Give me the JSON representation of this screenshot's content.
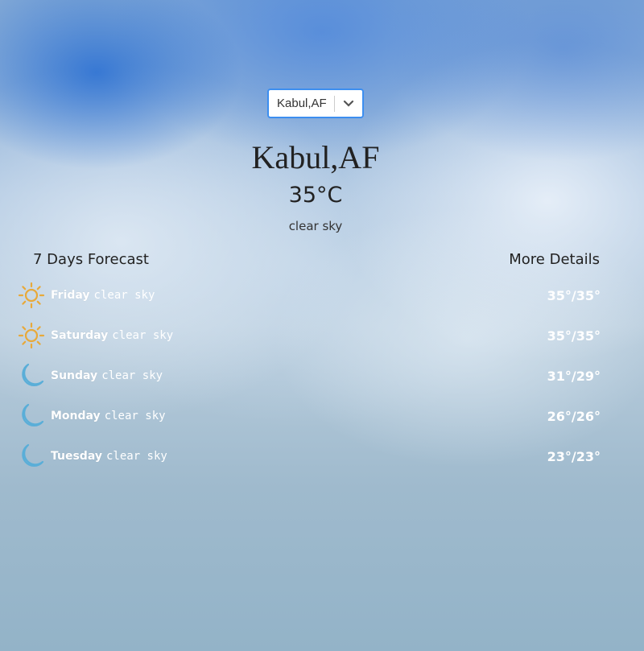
{
  "search": {
    "selected": "Kabul,AF"
  },
  "current": {
    "city": "Kabul,AF",
    "temperature": "35°C",
    "description": "clear sky"
  },
  "sections": {
    "forecast_title": "7 Days Forecast",
    "details_title": "More Details"
  },
  "forecast": [
    {
      "day": "Friday",
      "condition": "clear sky",
      "range": "35°/35°",
      "icon": "sun-icon"
    },
    {
      "day": "Saturday",
      "condition": "clear sky",
      "range": "35°/35°",
      "icon": "sun-icon"
    },
    {
      "day": "Sunday",
      "condition": "clear sky",
      "range": "31°/29°",
      "icon": "moon-icon"
    },
    {
      "day": "Monday",
      "condition": "clear sky",
      "range": "26°/26°",
      "icon": "moon-icon"
    },
    {
      "day": "Tuesday",
      "condition": "clear sky",
      "range": "23°/23°",
      "icon": "moon-icon"
    }
  ],
  "colors": {
    "sun": "#e8a93a",
    "moon": "#5aaed8",
    "select_border": "#3c8ef0"
  }
}
